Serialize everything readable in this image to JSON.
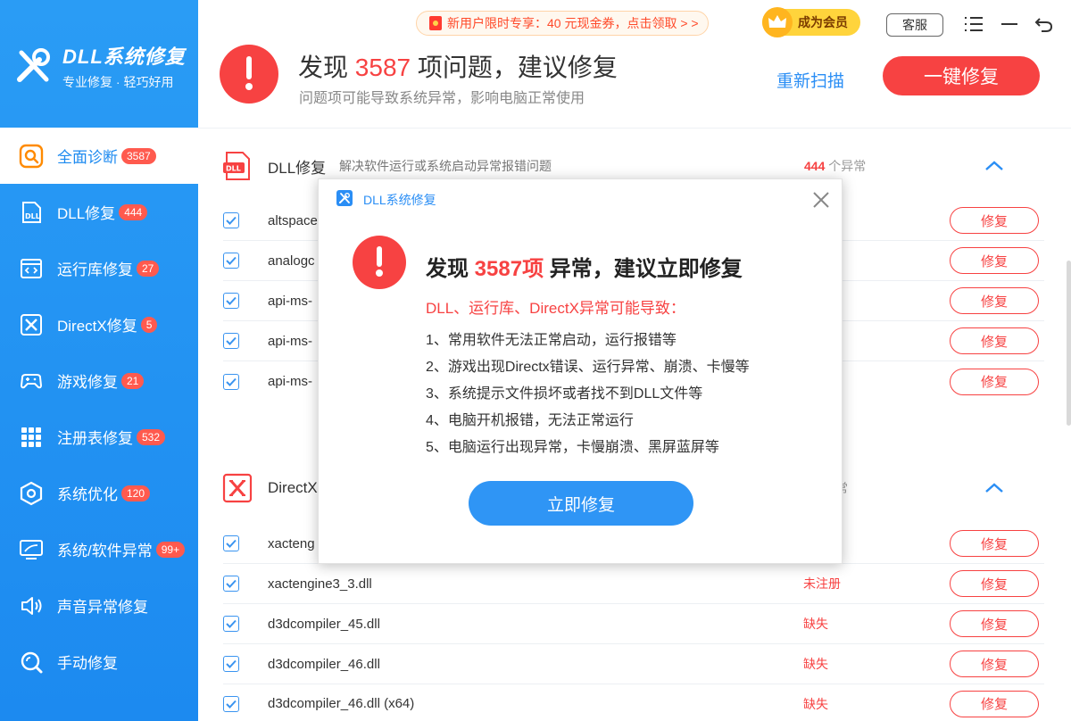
{
  "app": {
    "name": "DLL系统修复",
    "slogan": "专业修复 · 轻巧好用"
  },
  "sidebar": {
    "items": [
      {
        "label": "全面诊断",
        "badge": "3587",
        "icon": "search-icon"
      },
      {
        "label": "DLL修复",
        "badge": "444",
        "icon": "dll-icon"
      },
      {
        "label": "运行库修复",
        "badge": "27",
        "icon": "runtime-icon"
      },
      {
        "label": "DirectX修复",
        "badge": "5",
        "icon": "directx-icon"
      },
      {
        "label": "游戏修复",
        "badge": "21",
        "icon": "gamepad-icon"
      },
      {
        "label": "注册表修复",
        "badge": "532",
        "icon": "grid-icon"
      },
      {
        "label": "系统优化",
        "badge": "120",
        "icon": "hexagon-icon"
      },
      {
        "label": "系统/软件异常",
        "badge": "99+",
        "icon": "monitor-icon"
      },
      {
        "label": "声音异常修复",
        "badge": "",
        "icon": "speaker-icon"
      },
      {
        "label": "手动修复",
        "badge": "",
        "icon": "manual-search-icon"
      }
    ]
  },
  "header": {
    "promo": "新用户限时专享：40 元现金券，点击领取 > >",
    "vip": "成为会员",
    "service": "客服",
    "found_prefix": "发现",
    "found_count": "3587",
    "found_suffix": "项问题，建议修复",
    "found_sub": "问题项可能导致系统异常，影响电脑正常使用",
    "rescan": "重新扫描",
    "fix_all": "一键修复"
  },
  "sections": {
    "dll": {
      "title": "DLL修复",
      "desc": "解决软件运行或系统启动异常报错问题",
      "count": "444",
      "count_unit": "个异常",
      "rows": [
        {
          "name": "altspace",
          "status": "",
          "action": "修复"
        },
        {
          "name": "analogc",
          "status": "",
          "action": "修复"
        },
        {
          "name": "api-ms-",
          "status": "",
          "action": "修复"
        },
        {
          "name": "api-ms-",
          "status": "",
          "action": "修复"
        },
        {
          "name": "api-ms-",
          "status": "",
          "action": "修复"
        }
      ]
    },
    "directx": {
      "title": "DirectX",
      "count_unit": "常",
      "rows": [
        {
          "name": "xacteng",
          "status": "",
          "action": "修复"
        },
        {
          "name": "xactengine3_3.dll",
          "status": "未注册",
          "action": "修复"
        },
        {
          "name": "d3dcompiler_45.dll",
          "status": "缺失",
          "action": "修复"
        },
        {
          "name": "d3dcompiler_46.dll",
          "status": "缺失",
          "action": "修复"
        },
        {
          "name": "d3dcompiler_46.dll (x64)",
          "status": "缺失",
          "action": "修复"
        }
      ]
    }
  },
  "dialog": {
    "title": "DLL系统修复",
    "head_prefix": "发现",
    "head_count": "3587项",
    "head_suffix": "异常，建议立即修复",
    "warn": "DLL、运行库、DirectX异常可能导致：",
    "items": [
      "1、常用软件无法正常启动，运行报错等",
      "2、游戏出现Directx错误、运行异常、崩溃、卡慢等",
      "3、系统提示文件损坏或者找不到DLL文件等",
      "4、电脑开机报错，无法正常运行",
      "5、电脑运行出现异常，卡慢崩溃、黑屏蓝屏等"
    ],
    "button": "立即修复"
  },
  "colors": {
    "primary": "#2a8ef5",
    "danger": "#f74242",
    "sidebar": "#1c8af0"
  }
}
